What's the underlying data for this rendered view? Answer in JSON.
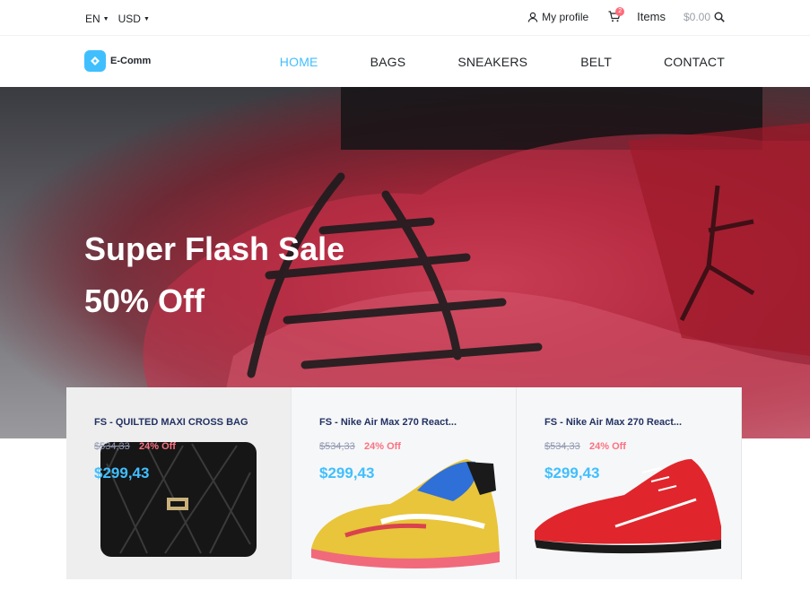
{
  "topbar": {
    "language": "EN",
    "currency": "USD",
    "profile_label": "My profile",
    "cart_count": "2",
    "items_label": "Items",
    "cart_total": "$0.00"
  },
  "brand": {
    "name": "E-Comm",
    "accent": "#40bfff"
  },
  "nav": {
    "items": [
      {
        "label": "HOME",
        "active": true
      },
      {
        "label": "BAGS"
      },
      {
        "label": "SNEAKERS"
      },
      {
        "label": "BELT"
      },
      {
        "label": "CONTACT"
      }
    ]
  },
  "hero": {
    "title": "Super Flash Sale",
    "subtitle": "50% Off"
  },
  "products": [
    {
      "name": "FS - QUILTED MAXI CROSS BAG",
      "old_price": "$534,33",
      "discount": "24% Off",
      "price": "$299,43"
    },
    {
      "name": "FS - Nike Air Max 270 React...",
      "old_price": "$534,33",
      "discount": "24% Off",
      "price": "$299,43"
    },
    {
      "name": "FS - Nike Air Max 270 React...",
      "old_price": "$534,33",
      "discount": "24% Off",
      "price": "$299,43"
    }
  ]
}
